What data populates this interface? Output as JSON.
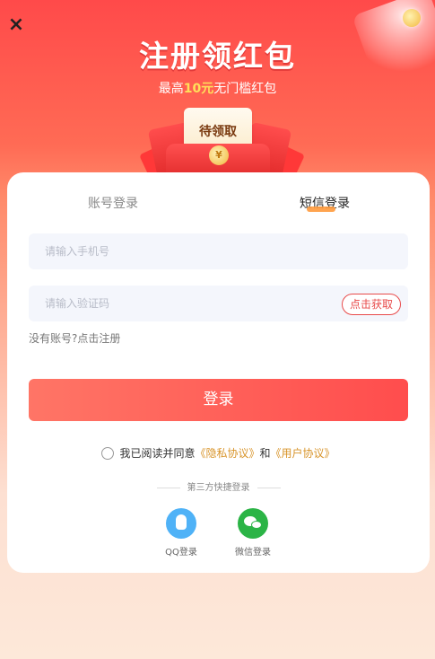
{
  "close_icon": "×",
  "hero": {
    "title": "注册领红包",
    "subtitle_prefix": "最高",
    "subtitle_amount": "10元",
    "subtitle_suffix": "无门槛红包",
    "packet_label": "待领取",
    "packet_coin": "¥"
  },
  "tabs": {
    "account": "账号登录",
    "sms": "短信登录",
    "active": "sms"
  },
  "form": {
    "phone_placeholder": "请输入手机号",
    "code_placeholder": "请输入验证码",
    "get_code_label": "点击获取",
    "register_link": "没有账号?点击注册",
    "login_button": "登录"
  },
  "agreement": {
    "prefix": "我已阅读并同意",
    "privacy": "《隐私协议》",
    "and": "和",
    "user": "《用户协议》",
    "checked": false
  },
  "third_party": {
    "title": "第三方快捷登录",
    "qq_label": "QQ登录",
    "wechat_label": "微信登录"
  },
  "colors": {
    "accent": "#ff4d4d",
    "link": "#d8942a",
    "qq": "#4fb2f7",
    "wechat": "#2bb446"
  }
}
